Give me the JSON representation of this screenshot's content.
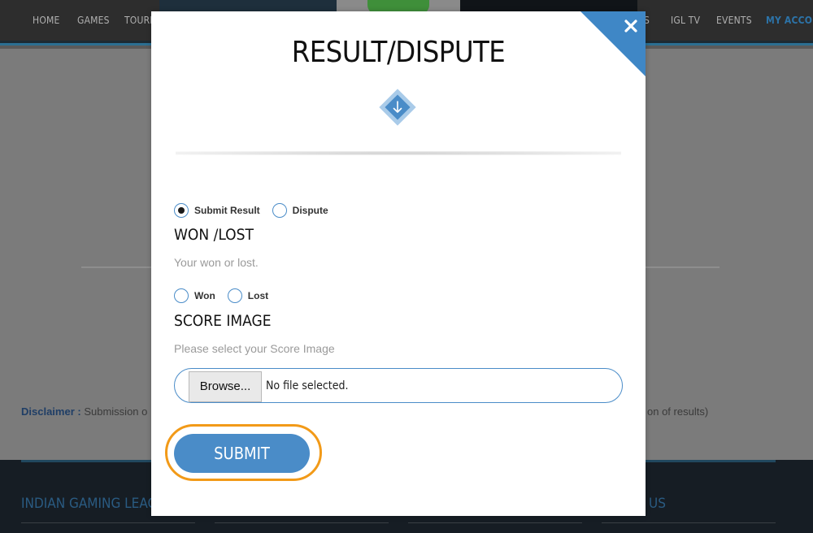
{
  "nav": {
    "items": [
      "HOME",
      "GAMES",
      "TOURN",
      "S",
      "IGL TV",
      "EVENTS",
      "MY ACCOU"
    ],
    "active_index": 6
  },
  "background": {
    "disclaimer_label": "Disclaimer :",
    "disclaimer_left": "Submission o",
    "disclaimer_right": "on of results)",
    "footer_heading_left": "INDIAN GAMING LEAGUE",
    "footer_heading_right": "US"
  },
  "modal": {
    "title": "RESULT/DISPUTE",
    "result_options": [
      {
        "label": "Submit Result",
        "checked": true
      },
      {
        "label": "Dispute",
        "checked": false
      }
    ],
    "won_lost": {
      "heading": "WON /LOST",
      "description": "Your won or lost.",
      "options": [
        {
          "label": "Won",
          "checked": false
        },
        {
          "label": "Lost",
          "checked": false
        }
      ]
    },
    "score_image": {
      "heading": "SCORE IMAGE",
      "description": "Please select your Score Image",
      "browse_label": "Browse...",
      "file_status": "No file selected."
    },
    "submit_label": "SUBMIT"
  },
  "colors": {
    "accent": "#4a8cc8",
    "corner": "#3f87c6",
    "highlight_ring": "#f29a18",
    "nav_active": "#2c73a8"
  }
}
